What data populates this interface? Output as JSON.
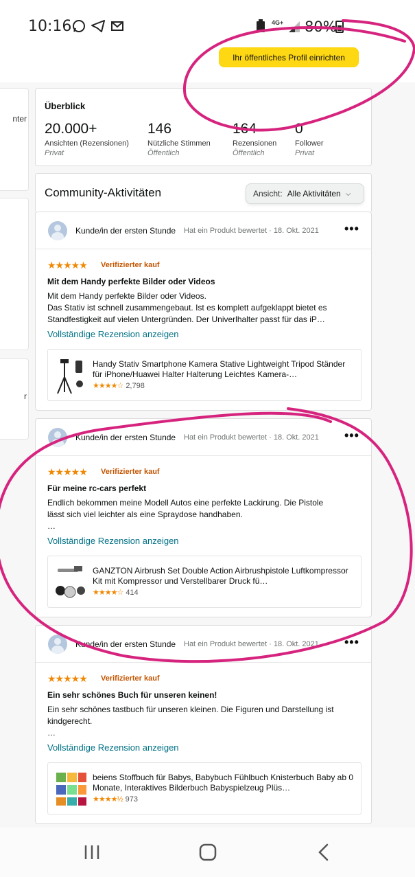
{
  "status_bar": {
    "time": "10:16",
    "battery": "80%",
    "network": "4G+"
  },
  "header": {
    "profile_button": "Ihr öffentliches Profil einrichten"
  },
  "left_partial": {
    "card1_text": "nter",
    "card3_text": "r"
  },
  "overview": {
    "title": "Überblick",
    "stats": [
      {
        "value": "20.000+",
        "label": "Ansichten (Rezensionen)",
        "visibility": "Privat"
      },
      {
        "value": "146",
        "label": "Nützliche Stimmen",
        "visibility": "Öffentlich"
      },
      {
        "value": "164",
        "label": "Rezensionen",
        "visibility": "Öffentlich"
      },
      {
        "value": "0",
        "label": "Follower",
        "visibility": "Privat"
      }
    ]
  },
  "activity": {
    "title": "Community-Aktivitäten",
    "filter_label": "Ansicht:",
    "filter_value": "Alle Aktivitäten"
  },
  "reviews": [
    {
      "user": "Kunde/in der ersten Stunde",
      "meta": "Hat ein Produkt bewertet · 18. Okt. 2021",
      "stars": "★★★★★",
      "verified": "Verifizierter kauf",
      "title": "Mit dem Handy perfekte Bilder oder Videos",
      "body_lines": [
        "Mit dem Handy perfekte Bilder oder Videos.",
        "Das Stativ ist schnell zusammengebaut. Ist es komplett aufgeklappt bietet es",
        "Standfestigkeit auf vielen Untergründen. Der Univerlhalter passt für das iP…"
      ],
      "link": "Vollständige Rezension anzeigen",
      "product_title": "Handy Stativ Smartphone Kamera Stative Lightweight Tripod Ständer für iPhone/Huawei Halter Halterung Leichtes Kamera-…",
      "product_stars": "★★★★☆",
      "product_count": "2,798"
    },
    {
      "user": "Kunde/in der ersten Stunde",
      "meta": "Hat ein Produkt bewertet · 18. Okt. 2021",
      "stars": "★★★★★",
      "verified": "Verifizierter kauf",
      "title": "Für meine rc-cars perfekt",
      "body_lines": [
        "Endlich bekommen meine Modell Autos eine perfekte Lackirung. Die Pistole",
        "lässt sich viel leichter als eine Spraydose handhaben.",
        "…"
      ],
      "link": "Vollständige Rezension anzeigen",
      "product_title": "GANZTON Airbrush Set Double Action Airbrushpistole Luftkompressor Kit mit Kompressor und Verstellbarer Druck fü…",
      "product_stars": "★★★★☆",
      "product_count": "414"
    },
    {
      "user": "Kunde/in der ersten Stunde",
      "meta": "Hat ein Produkt bewertet · 18. Okt. 2021",
      "stars": "★★★★★",
      "verified": "Verifizierter kauf",
      "title": "Ein sehr schönes Buch für unseren keinen!",
      "body_lines": [
        "Ein sehr schönes tastbuch für unseren kleinen. Die Figuren und Darstellung ist",
        "kindgerecht.",
        "…"
      ],
      "link": "Vollständige Rezension anzeigen",
      "product_title": "beiens Stoffbuch für Babys, Babybuch Fühlbuch Knisterbuch Baby ab 0 Monate, Interaktives Bilderbuch Babyspielzeug Plüs…",
      "product_stars": "★★★★½",
      "product_count": "973"
    }
  ],
  "colors": {
    "button_yellow": "#ffd814",
    "star_orange": "#f08804",
    "verified": "#c45500",
    "link_teal": "#007185",
    "annotation_pink": "#d6247e"
  }
}
